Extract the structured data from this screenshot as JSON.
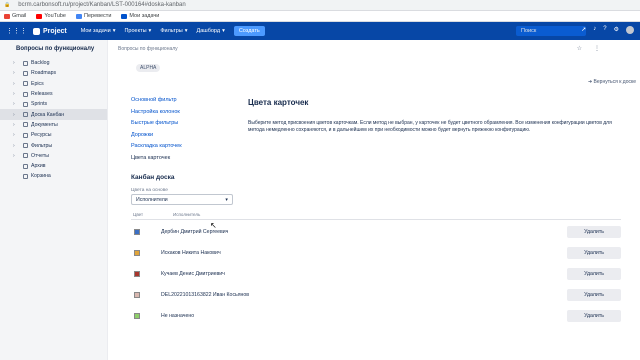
{
  "browser": {
    "url": "bcrm.carbonsoft.ru/project/Kanban/LST-000164#doska-kanban"
  },
  "bookmarks": [
    {
      "label": "Gmail",
      "color": "#ea4335"
    },
    {
      "label": "YouTube",
      "color": "#ff0000"
    },
    {
      "label": "Перевести",
      "color": "#4285f4"
    },
    {
      "label": "Мои задачи",
      "color": "#0052cc"
    }
  ],
  "topnav": {
    "brand": "Project",
    "items": [
      "Мои задачи",
      "Проекты",
      "Фильтры",
      "Дашборд"
    ],
    "create": "Создать",
    "search_placeholder": "Поиск"
  },
  "sidebar": {
    "title": "Вопросы по функционалу",
    "items": [
      {
        "label": "Backlog",
        "active": false,
        "chevron": true
      },
      {
        "label": "Roadmaps",
        "active": false,
        "chevron": true
      },
      {
        "label": "Epics",
        "active": false,
        "chevron": true
      },
      {
        "label": "Releases",
        "active": false,
        "chevron": true
      },
      {
        "label": "Sprints",
        "active": false,
        "chevron": true
      },
      {
        "label": "Доска Канбан",
        "active": true,
        "chevron": true
      },
      {
        "label": "Документы",
        "active": false,
        "chevron": true
      },
      {
        "label": "Ресурсы",
        "active": false,
        "chevron": true
      },
      {
        "label": "Фильтры",
        "active": false,
        "chevron": true
      },
      {
        "label": "Отчеты",
        "active": false,
        "chevron": true
      },
      {
        "label": "Архив",
        "active": false,
        "chevron": false
      },
      {
        "label": "Корзина",
        "active": false,
        "chevron": false
      }
    ]
  },
  "main": {
    "breadcrumb": "Вопросы по функционалу",
    "badge": "ALPHA",
    "back_link": "Вернуться к доске",
    "settings_nav": [
      {
        "label": "Основной фильтр",
        "current": false
      },
      {
        "label": "Настройка колонок",
        "current": false
      },
      {
        "label": "Быстрые фильтры",
        "current": false
      },
      {
        "label": "Дорожки",
        "current": false
      },
      {
        "label": "Раскладка карточек",
        "current": false
      },
      {
        "label": "Цвета карточек",
        "current": true
      }
    ],
    "section_title": "Цвета карточек",
    "description": "Выберите метод присвоения цветов карточкам. Если метод не выбран, у карточек не будет цветного обрамления. Все изменения конфигурации цветов для метода немедленно сохраняются, и в дальнейшем их при необходимости можно будет вернуть прежнюю конфигурацию.",
    "board_title": "Канбан доска",
    "scheme_label": "Цвета на основе",
    "scheme_value": "Исполнители",
    "col_color": "Цвет",
    "col_user": "Исполнитель",
    "delete_label": "Удалить",
    "rows": [
      {
        "user": "Дербин Дмитрий Сергеевич",
        "color": "#3b6fc4"
      },
      {
        "user": "Искаков Никита Накович",
        "color": "#e0a43a"
      },
      {
        "user": "Кучаев Денис Дмитриевич",
        "color": "#a9352c"
      },
      {
        "user": "DEL20221013163822 Иван Косьянов",
        "color": "#d9b8b0"
      },
      {
        "user": "Не назначено",
        "color": "#8fcf6a"
      }
    ]
  }
}
